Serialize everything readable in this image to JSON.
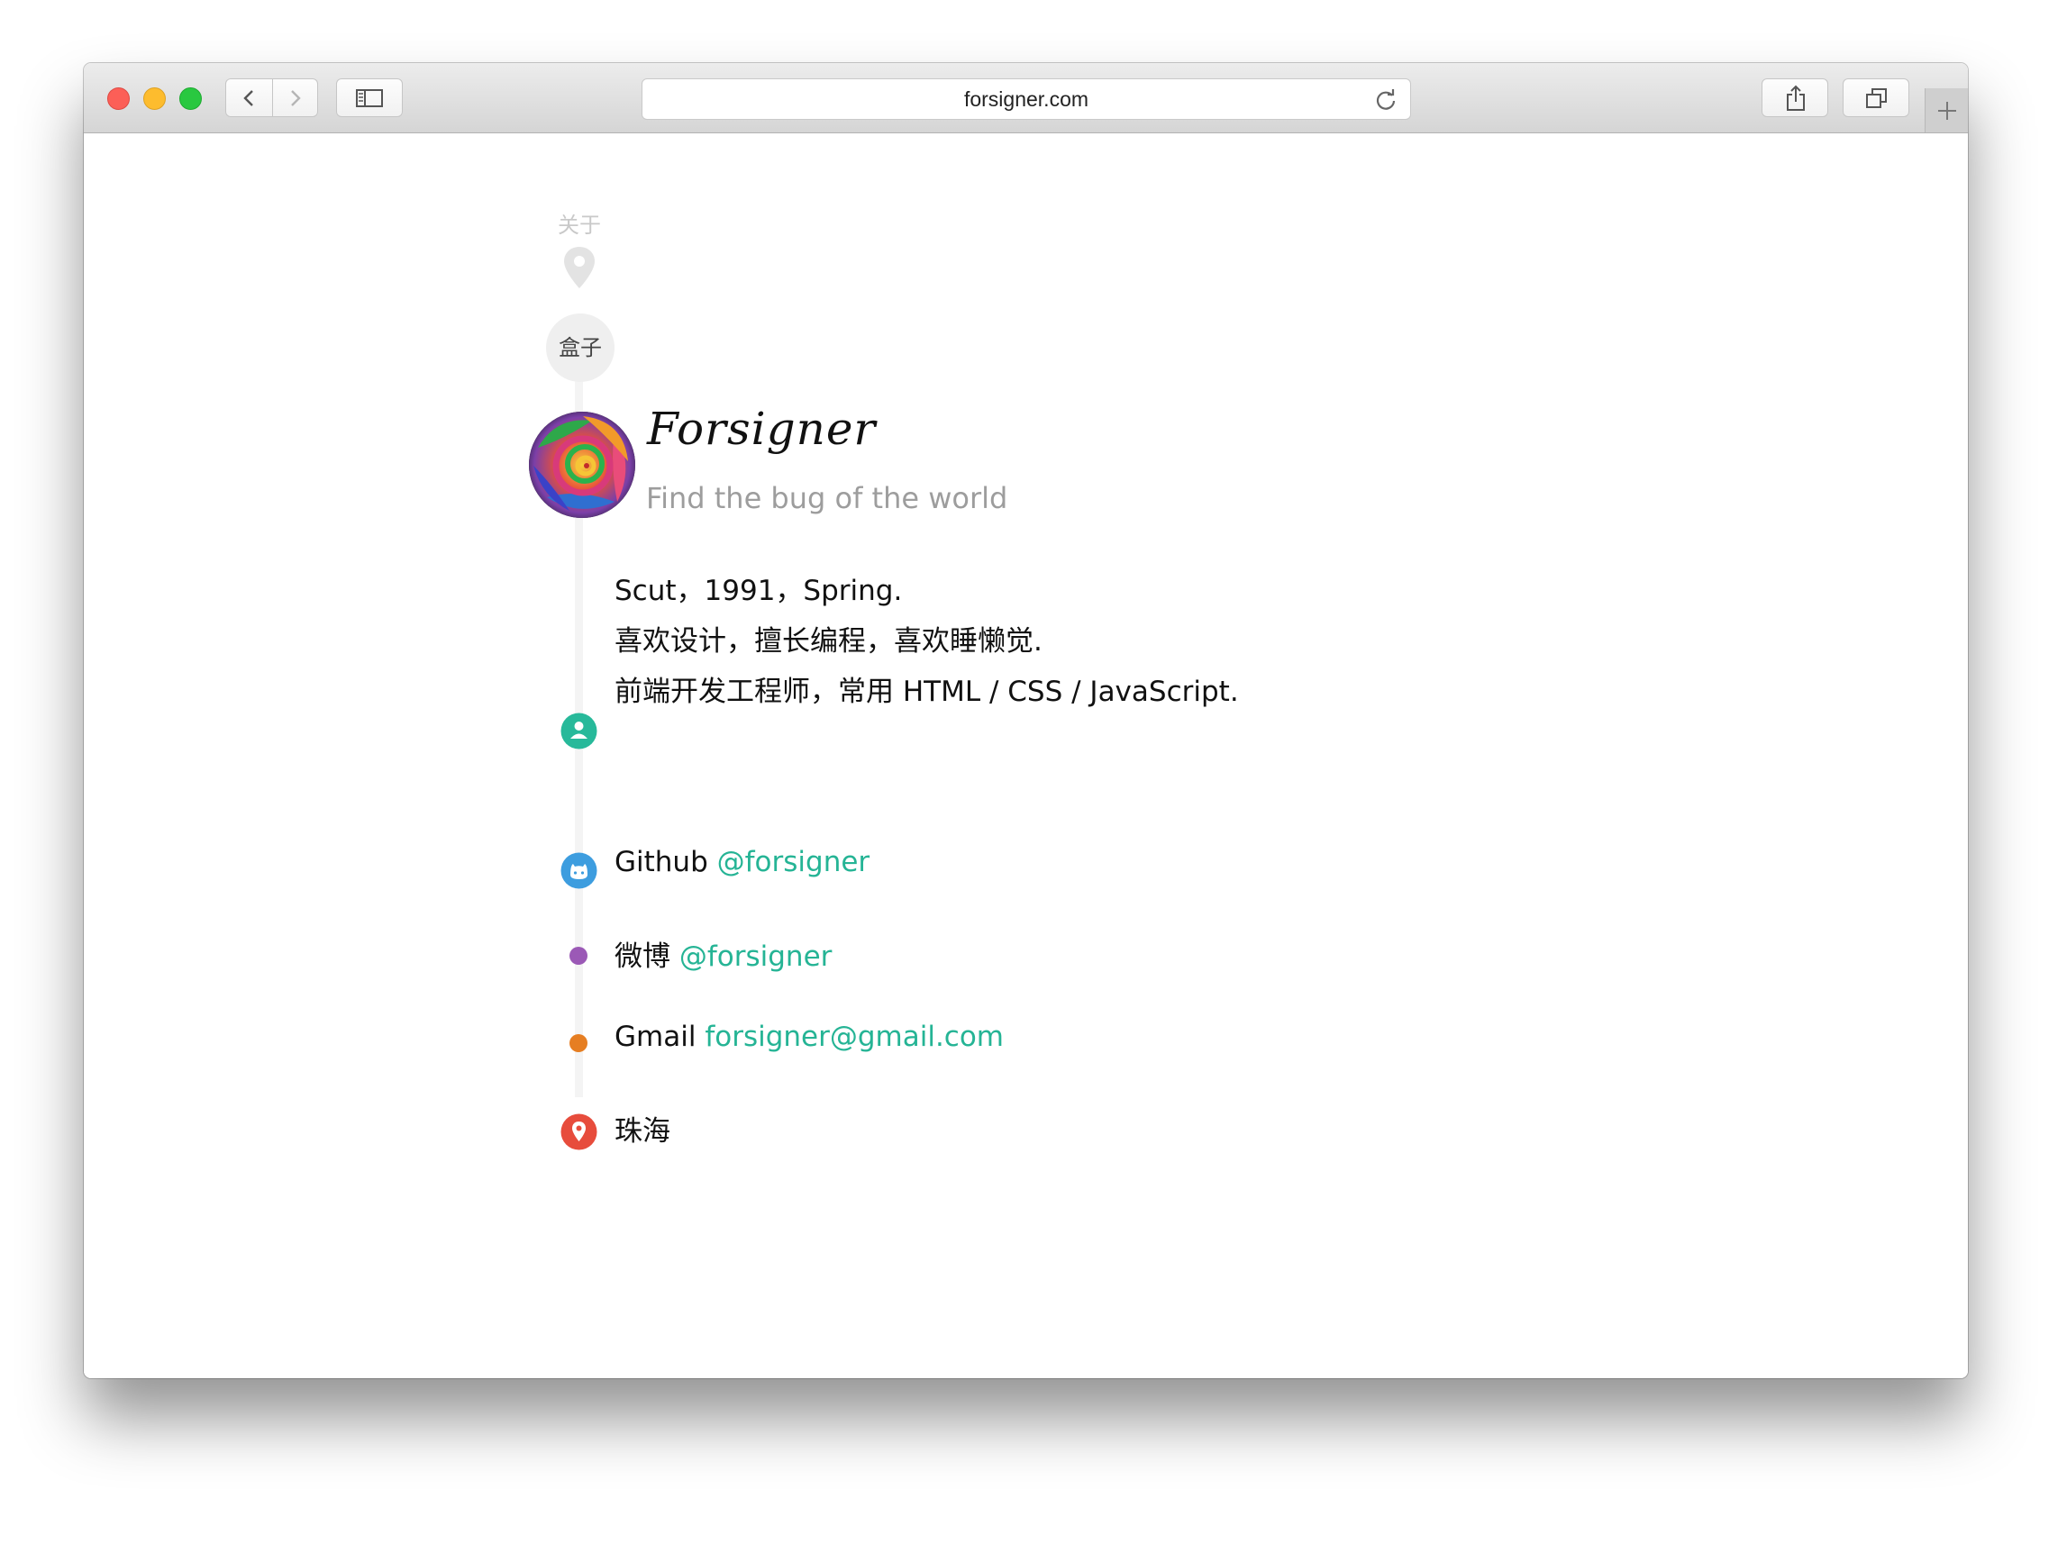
{
  "browser": {
    "url": "forsigner.com"
  },
  "page": {
    "section_label": "关于",
    "box_label": "盒子",
    "site_title": "Forsigner",
    "site_subtitle": "Find the bug of the world",
    "bio": [
      "Scut，1991，Spring.",
      "喜欢设计，擅长编程，喜欢睡懒觉.",
      "前端开发工程师，常用 HTML / CSS / JavaScript."
    ],
    "github": {
      "label": "Github",
      "handle": "@forsigner"
    },
    "weibo": {
      "label": "微博",
      "handle": "@forsigner"
    },
    "gmail": {
      "label": "Gmail",
      "address": "forsigner@gmail.com"
    },
    "location": "珠海"
  },
  "colors": {
    "link": "#25b495",
    "person_icon": "#27b99a",
    "github_icon": "#3d9ddf",
    "weibo_dot": "#9b59b6",
    "gmail_dot": "#e67e22",
    "location_icon": "#e74c3c"
  }
}
